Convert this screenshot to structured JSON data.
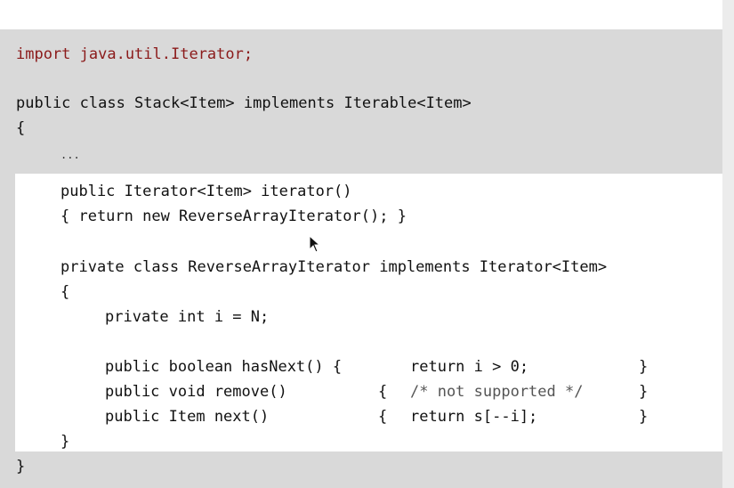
{
  "code": {
    "import_line": "import java.util.Iterator;",
    "class_decl": "public class Stack<Item> implements Iterable<Item>",
    "class_open_brace": "{",
    "ellipsis": "...",
    "iterator_sig": "public Iterator<Item> iterator()",
    "iterator_body": "{ return new ReverseArrayIterator(); }",
    "inner_class_decl": "private class ReverseArrayIterator implements Iterator<Item>",
    "inner_open_brace": "{",
    "field_decl": "private int i = N;",
    "hasnext_sig": "public boolean hasNext() {",
    "hasnext_body": "return i > 0;",
    "remove_sig": "public void remove()",
    "remove_open": "{",
    "remove_comment": "/* not supported */",
    "next_sig": "public Item next()",
    "next_open": "{",
    "next_body": "return s[--i];",
    "method_close": "}",
    "inner_close_brace": "}",
    "class_close_brace": "}"
  },
  "colors": {
    "import_keyword": "#8b1a1a",
    "gray_band": "#d9d9d9",
    "highlight": "#ffffff"
  },
  "icons": {
    "cursor": "mouse-pointer-icon"
  }
}
